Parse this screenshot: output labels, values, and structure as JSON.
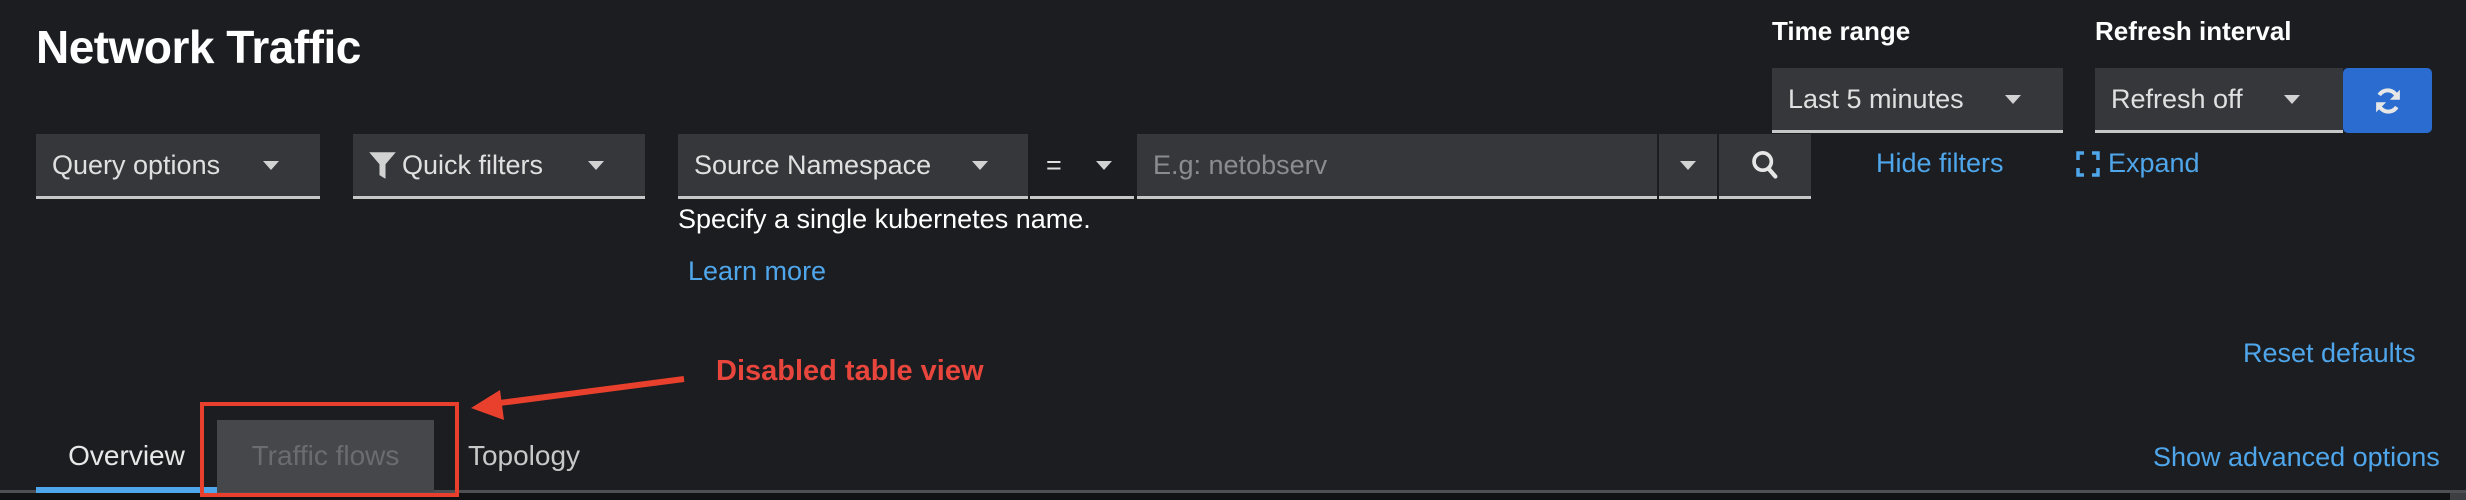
{
  "header": {
    "title": "Network Traffic"
  },
  "time_range": {
    "label": "Time range",
    "selected": "Last 5 minutes"
  },
  "refresh_interval": {
    "label": "Refresh interval",
    "selected": "Refresh off",
    "refresh_icon": "sync-icon"
  },
  "filters": {
    "query_options_label": "Query options",
    "quick_filters_label": "Quick filters",
    "quick_filters_icon": "filter-icon",
    "filter_field": "Source Namespace",
    "comparator": "=",
    "value": "",
    "value_placeholder": "E.g: netobserv",
    "search_icon": "search-icon",
    "helper_text": "Specify a single kubernetes name.",
    "learn_more": "Learn more",
    "hide_filters": "Hide filters",
    "expand": "Expand",
    "expand_icon": "expand-icon"
  },
  "actions": {
    "reset_defaults": "Reset defaults",
    "show_advanced_options": "Show advanced options"
  },
  "tabs": [
    {
      "label": "Overview",
      "active": true,
      "disabled": false
    },
    {
      "label": "Traffic flows",
      "active": false,
      "disabled": true
    },
    {
      "label": "Topology",
      "active": false,
      "disabled": false
    }
  ],
  "annotation": {
    "text": "Disabled table view",
    "color": "#e8463c"
  },
  "colors": {
    "accent": "#4fa6ea",
    "primary_button": "#2a6ccf",
    "background": "#1b1d21",
    "control_background": "#36373b"
  }
}
